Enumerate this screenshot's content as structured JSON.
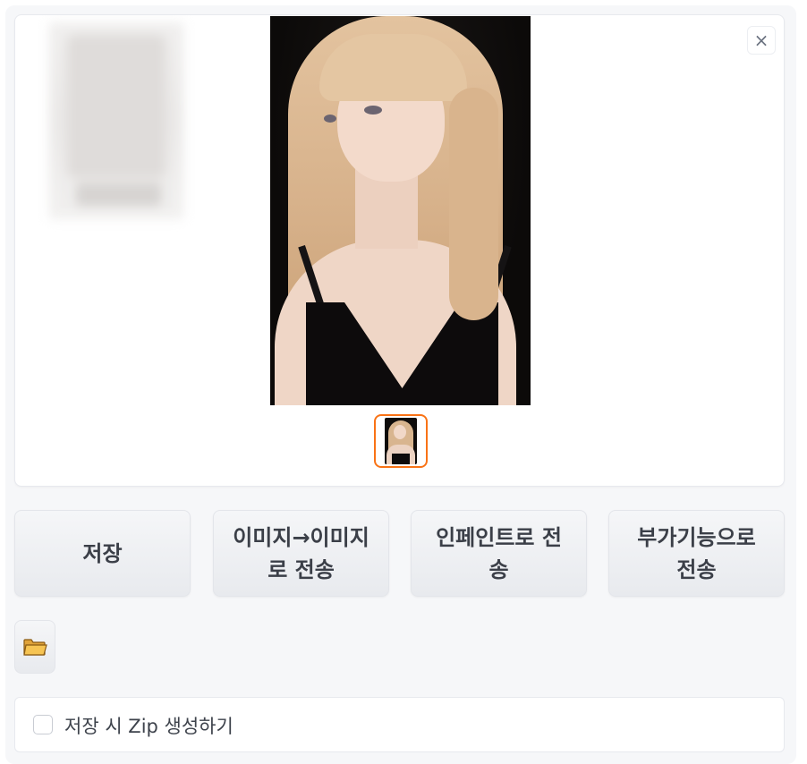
{
  "gallery": {
    "close_symbol": "×"
  },
  "buttons": {
    "save": "저장",
    "img2img": "이미지→이미지로 전송",
    "inpaint": "인페인트로 전송",
    "extras": "부가기능으로 전송"
  },
  "options": {
    "zip_label": "저장 시 Zip 생성하기"
  },
  "icons": {
    "folder": "folder-icon",
    "close": "close-icon"
  },
  "colors": {
    "accent": "#f97316"
  }
}
